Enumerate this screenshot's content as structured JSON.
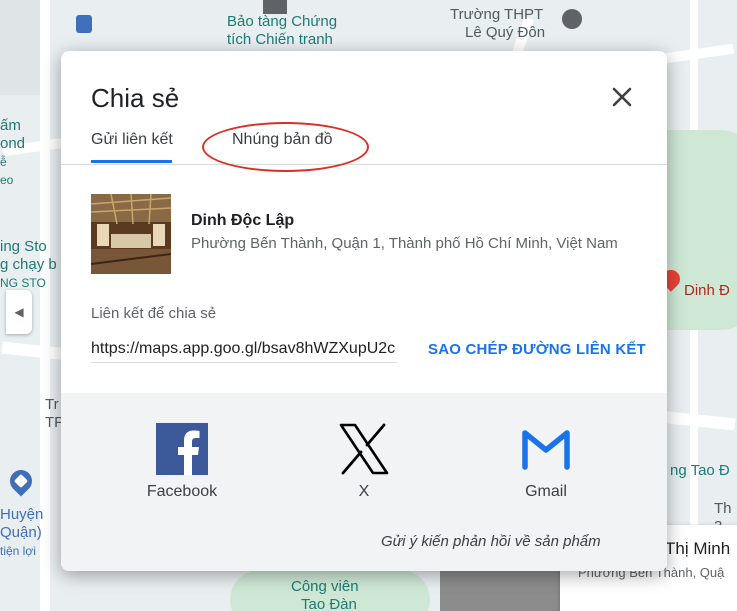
{
  "map": {
    "labels": {
      "museum": [
        "Bảo tàng Chứng",
        "tích Chiến tranh"
      ],
      "school": [
        "Trường THPT",
        "Lê Quý Đôn"
      ],
      "left_top": [
        "ấm",
        "ond",
        "ễ",
        "eo"
      ],
      "left_mid": [
        "ing Sto",
        "g chạy b",
        "NG STO"
      ],
      "left_low": [
        "Tr",
        "TP"
      ],
      "district": [
        "Huyện",
        "Quận)",
        "tiện lợi"
      ],
      "right_pin": "Dinh Đ",
      "right_mid": "ng Tao Đ",
      "right_th": [
        "Th",
        "3"
      ],
      "park": [
        "Công viên",
        "Tao Đàn"
      ]
    },
    "place_card": {
      "title": "Thị Minh",
      "address": "Phường Bến Thành, Quậ"
    }
  },
  "dialog": {
    "title": "Chia sẻ",
    "tabs": [
      {
        "label": "Gửi liên kết",
        "active": true
      },
      {
        "label": "Nhúng bản đồ",
        "active": false
      }
    ],
    "place": {
      "name": "Dinh Độc Lập",
      "address": "Phường Bến Thành, Quận 1, Thành phố Hồ Chí Minh, Việt Nam"
    },
    "link_label": "Liên kết để chia sẻ",
    "link_value": "https://maps.app.goo.gl/bsav8hWZXupU2c",
    "copy_button": "SAO CHÉP ĐƯỜNG LIÊN KẾT",
    "share_targets": [
      {
        "label": "Facebook",
        "icon": "facebook-icon"
      },
      {
        "label": "X",
        "icon": "x-icon"
      },
      {
        "label": "Gmail",
        "icon": "gmail-icon"
      }
    ],
    "feedback": "Gửi ý kiến phản hồi về sản phẩm"
  },
  "colors": {
    "accent": "#1a73e8",
    "highlight_circle": "#d93025",
    "facebook": "#3b5998"
  }
}
